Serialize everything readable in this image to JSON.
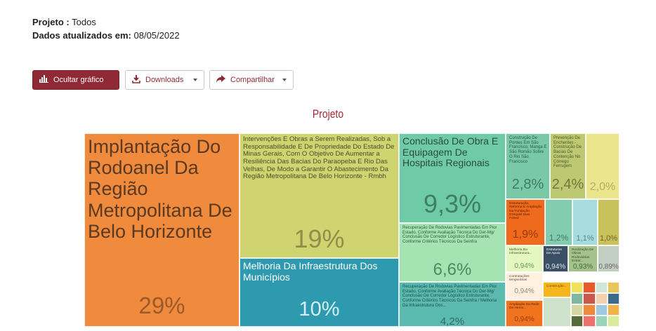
{
  "header": {
    "project_label": "Projeto :",
    "project_value": "Todos",
    "updated_label": "Dados atualizados em:",
    "updated_value": "08/05/2022"
  },
  "toolbar": {
    "hide_chart_label": "Ocultar gráfico",
    "downloads_label": "Downloads",
    "share_label": "Compartilhar"
  },
  "chart_data": {
    "type": "treemap",
    "title": "Projeto",
    "items": [
      {
        "label": "Implantação Do Rodoanel Da Região Metropolitana De Belo Horizonte",
        "value": 29,
        "value_label": "29%",
        "color": "#f08a3c"
      },
      {
        "label": "Intervenções E Obras a Serem Realizadas, Sob a Responsabilidade E De Propriedade Do Estado De Minas Gerais, Com O Objetivo De Aumentar a Resiliência Das Bacias Do Paraopeba E Rio Das Velhas, De Modo a Garantir O Abastecimento Da Região Metropolitana De Belo Horizonte - Rmbh",
        "value": 19,
        "value_label": "19%",
        "color": "#cfd370"
      },
      {
        "label": "Melhoria Da Infraestrutura Dos Municípios",
        "value": 10,
        "value_label": "10%",
        "color": "#2e9ab0"
      },
      {
        "label": "Conclusão De Obra E Equipagem De Hospitais Regionais",
        "value": 9.3,
        "value_label": "9,3%",
        "color": "#6fcba7"
      },
      {
        "label": "Recuperação De Rodovias Pavimentadas Em Pior Estado, Conforme Avaliação Técnica Do Der-Mg/ Conclusão De Corredor Logístico Estruturante, Conforme Critérios Técnicos Da Seinfra",
        "value": 6.6,
        "value_label": "6,6%",
        "color": "#a6e3b2"
      },
      {
        "label": "Recuperação De Rodovias Pavimentadas Em Pior Estado, Conforme Avaliação Técnica Do Der-Mg/ Conclusão De Corredor Logístico Estruturante, Conforme Critérios Técnicos Da Seinfra / Melhoria Da Infraestrutura Dos...",
        "value": 4.2,
        "value_label": "4,2%",
        "color": "#5bbab0"
      },
      {
        "label": "Construção De Pontes Em São Francisco, Manga E São Romão Sobre O Rio São Francisco",
        "value": 2.8,
        "value_label": "2,8%",
        "color": "#79c9a8"
      },
      {
        "label": "Prevenção De Enchentes - Construção De Bacias De Contenção No Córrego Ferrugem",
        "value": 2.4,
        "value_label": "2,4%",
        "color": "#bdc872"
      },
      {
        "label": "",
        "value": 2.0,
        "value_label": "2,0%",
        "color": "#ebe58e"
      },
      {
        "label": "Estruturação, Reforma E Ampliação Da Fundação Ezequiel Dias - Funed",
        "value": 1.9,
        "value_label": "1,9%",
        "color": "#f06a1e"
      },
      {
        "label": "",
        "value": 1.2,
        "value_label": "1,2%",
        "color": "#83ccb0"
      },
      {
        "label": "",
        "value": 1.1,
        "value_label": "1,1%",
        "color": "#a8dcdc"
      },
      {
        "label": "",
        "value": 1.0,
        "value_label": "1,0%",
        "color": "#c9c15b"
      },
      {
        "label": "Melhoria Da Infraestrutura...",
        "value": 0.94,
        "value_label": "0,94%",
        "color": "#e4f7c1"
      },
      {
        "label": "Estruturas De Apoio",
        "value": 0.94,
        "value_label": "0,94%",
        "color": "#3b4f64"
      },
      {
        "label": "Realização De Obras Rodoviárias Estrat...",
        "value": 0.93,
        "value_label": "0,93%",
        "color": "#a6c28c"
      },
      {
        "label": "",
        "value": 0.89,
        "value_label": "0,89%",
        "color": "#c2cec2"
      },
      {
        "label": "Contratações temporárias",
        "value": 0.94,
        "value_label": "0,94%",
        "color": "#fff0e0"
      },
      {
        "label": "Ampliação Da Rede De Hemo...",
        "value": 0.94,
        "value_label": "0,94%",
        "color": "#f07420"
      },
      {
        "label": "Construção...",
        "value": null,
        "value_label": "",
        "color": "#f5b51f"
      }
    ]
  }
}
